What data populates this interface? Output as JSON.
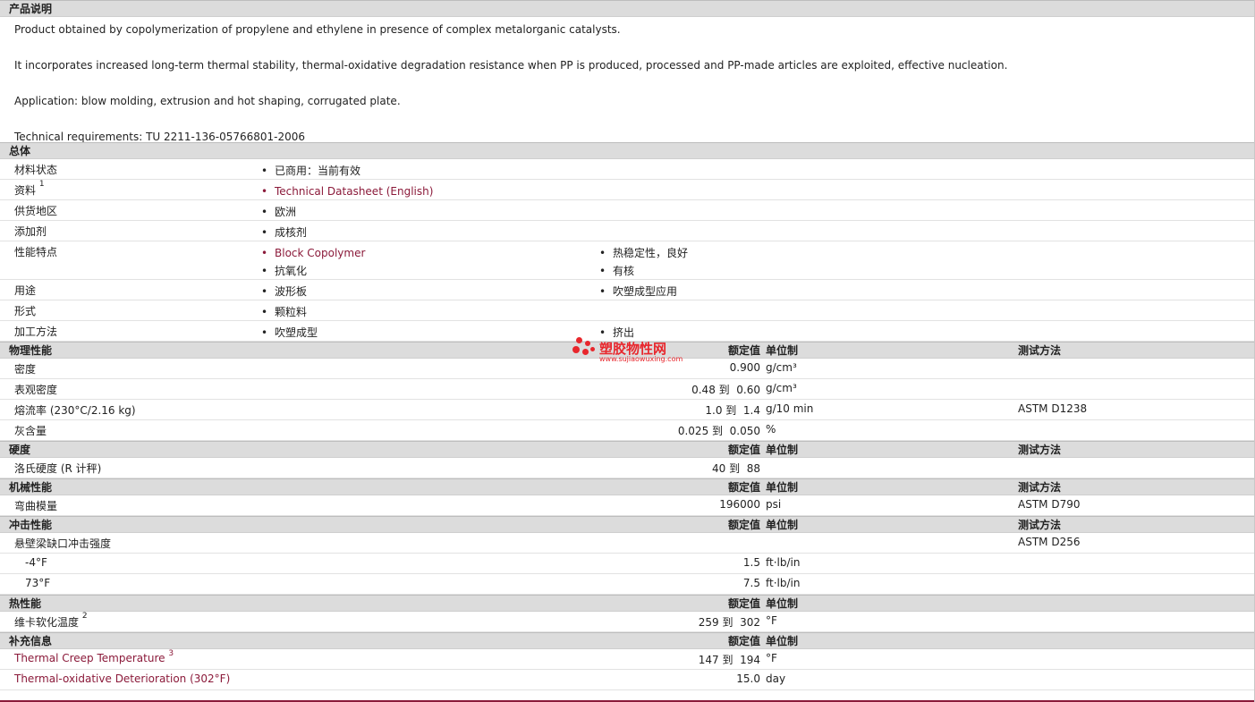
{
  "product_desc": {
    "title": "产品说明",
    "paragraphs": [
      "Product obtained by copolymerization of propylene and ethylene in presence of complex metalorganic catalysts.",
      "It incorporates increased long-term thermal stability, thermal-oxidative degradation resistance when PP is produced, processed and PP-made articles are exploited, effective nucleation.",
      "Application: blow molding, extrusion and hot shaping, corrugated plate.",
      "Technical requirements: TU 2211-136-05766801-2006"
    ]
  },
  "general": {
    "title": "总体",
    "rows": [
      {
        "label": "材料状态",
        "col1": [
          "已商用：当前有效"
        ],
        "col2": []
      },
      {
        "label": "资料",
        "sup": "1",
        "col1": [
          "Technical Datasheet (English)"
        ],
        "col2": []
      },
      {
        "label": "供货地区",
        "col1": [
          "欧洲"
        ],
        "col2": []
      },
      {
        "label": "添加剂",
        "col1": [
          "成核剂"
        ],
        "col2": []
      },
      {
        "label": "性能特点",
        "col1": [
          "Block Copolymer",
          "抗氧化"
        ],
        "col2": [
          "热稳定性，良好",
          "有核"
        ]
      },
      {
        "label": "用途",
        "col1": [
          "波形板"
        ],
        "col2": [
          "吹塑成型应用"
        ]
      },
      {
        "label": "形式",
        "col1": [
          "颗粒料"
        ],
        "col2": []
      },
      {
        "label": "加工方法",
        "col1": [
          "吹塑成型"
        ],
        "col2": [
          "挤出"
        ]
      }
    ]
  },
  "headers": {
    "value": "额定值",
    "unit": "单位制",
    "method": "测试方法"
  },
  "physical": {
    "title": "物理性能",
    "rows": [
      {
        "label": "密度",
        "value": "0.900",
        "unit": "g/cm³",
        "method": ""
      },
      {
        "label": "表观密度",
        "value": "0.48 到  0.60",
        "unit": "g/cm³",
        "method": ""
      },
      {
        "label": "熔流率  (230°C/2.16 kg)",
        "value": "1.0 到  1.4",
        "unit": "g/10 min",
        "method": "ASTM D1238"
      },
      {
        "label": "灰含量",
        "value": "0.025 到  0.050",
        "unit": "%",
        "method": ""
      }
    ]
  },
  "hardness": {
    "title": "硬度",
    "rows": [
      {
        "label": "洛氏硬度  (R 计秤)",
        "value": "40 到  88",
        "unit": "",
        "method": ""
      }
    ]
  },
  "mechanical": {
    "title": "机械性能",
    "rows": [
      {
        "label": "弯曲模量",
        "value": "196000",
        "unit": "psi",
        "method": "ASTM D790"
      }
    ]
  },
  "impact": {
    "title": "冲击性能",
    "rows": [
      {
        "label": "悬壁梁缺口冲击强度",
        "value": "",
        "unit": "",
        "method": "ASTM D256"
      },
      {
        "label": "-4°F",
        "value": "1.5",
        "unit": "ft·lb/in",
        "method": "",
        "indent": true
      },
      {
        "label": "73°F",
        "value": "7.5",
        "unit": "ft·lb/in",
        "method": "",
        "indent": true
      }
    ]
  },
  "thermal": {
    "title": "热性能",
    "rows": [
      {
        "label": "维卡软化温度",
        "sup": "2",
        "value": "259 到  302",
        "unit": "°F",
        "method": ""
      }
    ]
  },
  "supplement": {
    "title": "补充信息",
    "rows": [
      {
        "label": "Thermal Creep Temperature",
        "sup": "3",
        "value": "147 到  194",
        "unit": "°F",
        "method": "",
        "link": true
      },
      {
        "label": "Thermal-oxidative Deterioration (302°F)",
        "value": "15.0",
        "unit": "day",
        "method": "",
        "link": true
      }
    ]
  },
  "watermark": {
    "name": "塑胶物性网",
    "url": "www.sujiaowuxing.com",
    "color": "#e8262c"
  }
}
